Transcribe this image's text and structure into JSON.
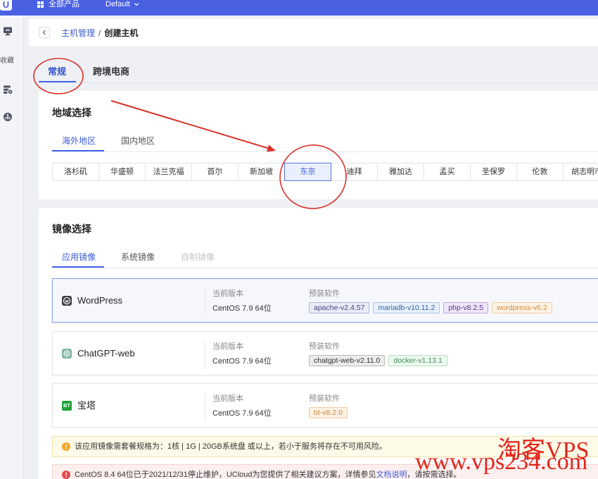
{
  "topbar": {
    "logo_text": "U",
    "products_label": "全部产品",
    "products_icon": "grid-icon",
    "project_label": "Default",
    "project_icon": "chevron-down-icon"
  },
  "sidebar": {
    "items": [
      {
        "icon": "monitor-icon"
      },
      {
        "label": "收藏"
      },
      {
        "icon": "server-settings-icon"
      },
      {
        "icon": "network-icon"
      }
    ]
  },
  "breadcrumb": {
    "back_icon": "chevron-left-icon",
    "parent": "主机管理",
    "separator": "/",
    "current": "创建主机"
  },
  "main_tabs": [
    {
      "label": "常规",
      "active": true
    },
    {
      "label": "跨境电商",
      "active": false
    }
  ],
  "region": {
    "title": "地域选择",
    "tabs": [
      {
        "label": "海外地区",
        "active": true
      },
      {
        "label": "国内地区",
        "active": false
      }
    ],
    "items": [
      "洛杉矶",
      "华盛顿",
      "法兰克福",
      "首尔",
      "新加坡",
      "东京",
      "迪拜",
      "雅加达",
      "孟买",
      "圣保罗",
      "伦敦",
      "胡志明市"
    ],
    "selected_index": 5
  },
  "image": {
    "title": "镜像选择",
    "tabs": [
      {
        "label": "应用镜像",
        "active": true,
        "disabled": false
      },
      {
        "label": "系统镜像",
        "active": false,
        "disabled": false
      },
      {
        "label": "自制镜像",
        "active": false,
        "disabled": true
      }
    ],
    "cards": [
      {
        "name": "WordPress",
        "icon": "wordpress-icon",
        "selected": true,
        "version_label": "当前版本",
        "version": "CentOS 7.9 64位",
        "software_label": "预装软件",
        "software": [
          "apache-v2.4.57",
          "mariadb-v10.11.2",
          "php-v8.2.5",
          "wordpress-v6.2"
        ]
      },
      {
        "name": "ChatGPT-web",
        "icon": "chatgpt-icon",
        "selected": false,
        "version_label": "当前版本",
        "version": "CentOS 7.9 64位",
        "software_label": "预装软件",
        "software": [
          "chatgpt-web-v2.11.0",
          "docker-v1.13.1"
        ]
      },
      {
        "name": "宝塔",
        "icon": "bt-icon",
        "icon_text": "BT",
        "selected": false,
        "version_label": "当前版本",
        "version": "CentOS 7.9 64位",
        "software_label": "预装软件",
        "software": [
          "bt-v8.2.0"
        ]
      }
    ]
  },
  "notices": {
    "warning": {
      "icon": "info-circle-icon",
      "text": "该应用镜像需套餐规格为：1核 | 1G | 20GB系统盘 或以上，若小于服务将存在不可用风险。"
    },
    "error": {
      "icon": "error-circle-icon",
      "text_before": "CentOS 8.4 64位已于2021/12/31停止维护，UCloud为您提供了相关建议方案，详情参见",
      "link": "文档说明",
      "text_after": "，请按需选择。"
    }
  },
  "watermark": {
    "brand": "淘客VPS",
    "url": "www.vps234.com"
  },
  "colors": {
    "topbar": "#4a60e3",
    "primary": "#4364e8",
    "annotation": "#d8322a",
    "watermark": "#e1251b",
    "warning_icon": "#f5a623",
    "error_icon": "#e5484d"
  }
}
